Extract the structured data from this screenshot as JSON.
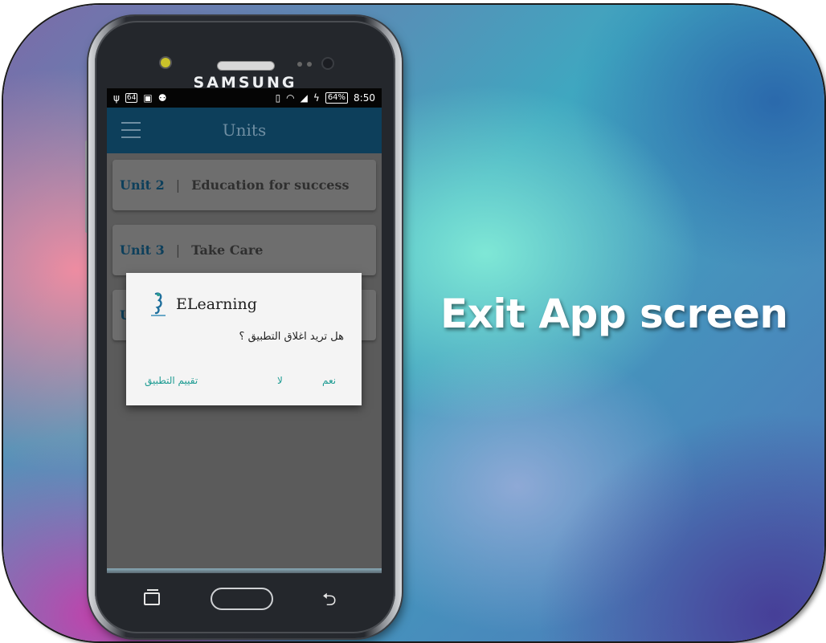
{
  "headline": "Exit App screen",
  "device": {
    "brand": "SAMSUNG"
  },
  "status_bar": {
    "left_icons": [
      "usb-icon",
      "sim-icon",
      "image-icon",
      "android-icon"
    ],
    "vibrate": "vibrate-icon",
    "wifi": "wifi-icon",
    "signal": "signal-icon",
    "battery": "64%",
    "time": "8:50",
    "sim_label": "64"
  },
  "app_bar": {
    "title": "Units"
  },
  "units": [
    {
      "number": "Unit 2",
      "separator": "|",
      "name": "Education for success"
    },
    {
      "number": "Unit 3",
      "separator": "|",
      "name": "Take Care"
    },
    {
      "number": "U",
      "separator": "",
      "name": ""
    }
  ],
  "dialog": {
    "title": "ELearning",
    "message": "هل تريد اغلاق التطبيق ؟",
    "buttons": {
      "rate": "تقييم التطبيق",
      "no": "لا",
      "yes": "نعم"
    }
  },
  "colors": {
    "appbar": "#0d3f5b",
    "accent": "#1f9c93",
    "screen_dim": "#5b5b5b"
  }
}
